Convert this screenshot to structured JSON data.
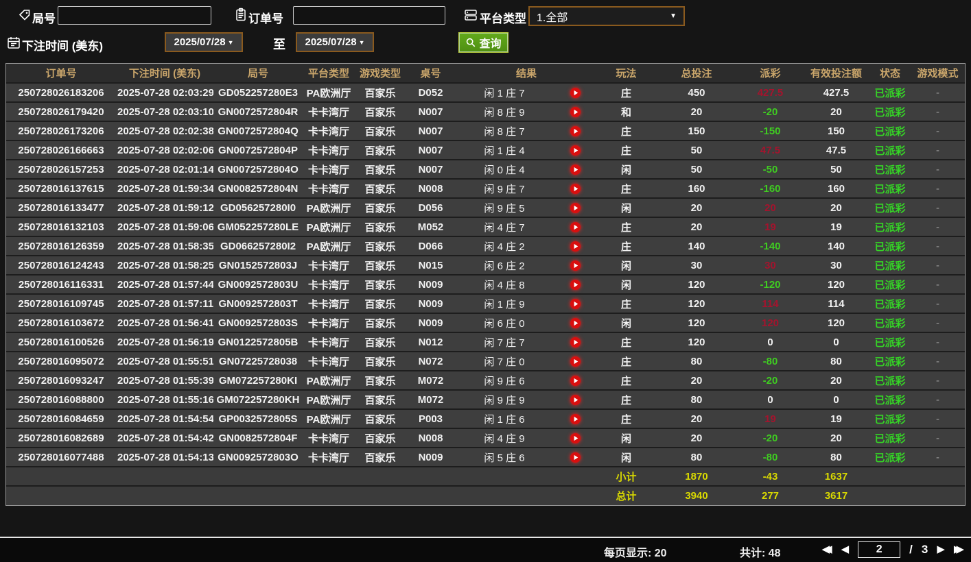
{
  "filters": {
    "game_no_label": "局号",
    "game_no_value": "",
    "order_no_label": "订单号",
    "order_no_value": "",
    "platform_label": "平台类型",
    "platform_value": "1.全部",
    "bet_time_label": "下注时间 (美东)",
    "date_from": "2025/07/28",
    "to_label": "至",
    "date_to": "2025/07/28",
    "search_label": "查询"
  },
  "icons": {
    "dropdown_arrow": "▼",
    "first_page": "◀◀",
    "prev_page": "◀",
    "next_page": "▶",
    "last_page": "▶▶"
  },
  "colors": {
    "header_gold": "#caa66b",
    "payout_win_red": "#a5132d",
    "payout_loss_green": "#3fcc21",
    "status_green": "#35d426",
    "summary_yellow": "#dada00",
    "button_green": "#55a016",
    "picker_border_orange": "#8a5a1e"
  },
  "table": {
    "headers": [
      "订单号",
      "下注时间 (美东)",
      "局号",
      "平台类型",
      "游戏类型",
      "桌号",
      "结果",
      "玩法",
      "总投注",
      "派彩",
      "有效投注额",
      "状态",
      "游戏模式"
    ],
    "rows": [
      {
        "order": "250728026183206",
        "time": "2025-07-28 02:03:29",
        "game": "GD052257280E3",
        "platform": "PA欧洲厅",
        "game_type": "百家乐",
        "table_no": "D052",
        "result": "闲 1 庄 7",
        "play": "庄",
        "bet": "450",
        "payout": "427.5",
        "payout_class": "win",
        "valid": "427.5",
        "status": "已派彩",
        "mode": "-"
      },
      {
        "order": "250728026179420",
        "time": "2025-07-28 02:03:10",
        "game": "GN0072572804R",
        "platform": "卡卡湾厅",
        "game_type": "百家乐",
        "table_no": "N007",
        "result": "闲 8 庄 9",
        "play": "和",
        "bet": "20",
        "payout": "-20",
        "payout_class": "loss",
        "valid": "20",
        "status": "已派彩",
        "mode": "-"
      },
      {
        "order": "250728026173206",
        "time": "2025-07-28 02:02:38",
        "game": "GN0072572804Q",
        "platform": "卡卡湾厅",
        "game_type": "百家乐",
        "table_no": "N007",
        "result": "闲 8 庄 7",
        "play": "庄",
        "bet": "150",
        "payout": "-150",
        "payout_class": "loss",
        "valid": "150",
        "status": "已派彩",
        "mode": "-"
      },
      {
        "order": "250728026166663",
        "time": "2025-07-28 02:02:06",
        "game": "GN0072572804P",
        "platform": "卡卡湾厅",
        "game_type": "百家乐",
        "table_no": "N007",
        "result": "闲 1 庄 4",
        "play": "庄",
        "bet": "50",
        "payout": "47.5",
        "payout_class": "win",
        "valid": "47.5",
        "status": "已派彩",
        "mode": "-"
      },
      {
        "order": "250728026157253",
        "time": "2025-07-28 02:01:14",
        "game": "GN0072572804O",
        "platform": "卡卡湾厅",
        "game_type": "百家乐",
        "table_no": "N007",
        "result": "闲 0 庄 4",
        "play": "闲",
        "bet": "50",
        "payout": "-50",
        "payout_class": "loss",
        "valid": "50",
        "status": "已派彩",
        "mode": "-"
      },
      {
        "order": "250728016137615",
        "time": "2025-07-28 01:59:34",
        "game": "GN0082572804N",
        "platform": "卡卡湾厅",
        "game_type": "百家乐",
        "table_no": "N008",
        "result": "闲 9 庄 7",
        "play": "庄",
        "bet": "160",
        "payout": "-160",
        "payout_class": "loss",
        "valid": "160",
        "status": "已派彩",
        "mode": "-"
      },
      {
        "order": "250728016133477",
        "time": "2025-07-28 01:59:12",
        "game": "GD056257280I0",
        "platform": "PA欧洲厅",
        "game_type": "百家乐",
        "table_no": "D056",
        "result": "闲 9 庄 5",
        "play": "闲",
        "bet": "20",
        "payout": "20",
        "payout_class": "win",
        "valid": "20",
        "status": "已派彩",
        "mode": "-"
      },
      {
        "order": "250728016132103",
        "time": "2025-07-28 01:59:06",
        "game": "GM052257280LE",
        "platform": "PA欧洲厅",
        "game_type": "百家乐",
        "table_no": "M052",
        "result": "闲 4 庄 7",
        "play": "庄",
        "bet": "20",
        "payout": "19",
        "payout_class": "win",
        "valid": "19",
        "status": "已派彩",
        "mode": "-"
      },
      {
        "order": "250728016126359",
        "time": "2025-07-28 01:58:35",
        "game": "GD066257280I2",
        "platform": "PA欧洲厅",
        "game_type": "百家乐",
        "table_no": "D066",
        "result": "闲 4 庄 2",
        "play": "庄",
        "bet": "140",
        "payout": "-140",
        "payout_class": "loss",
        "valid": "140",
        "status": "已派彩",
        "mode": "-"
      },
      {
        "order": "250728016124243",
        "time": "2025-07-28 01:58:25",
        "game": "GN0152572803J",
        "platform": "卡卡湾厅",
        "game_type": "百家乐",
        "table_no": "N015",
        "result": "闲 6 庄 2",
        "play": "闲",
        "bet": "30",
        "payout": "30",
        "payout_class": "win",
        "valid": "30",
        "status": "已派彩",
        "mode": "-"
      },
      {
        "order": "250728016116331",
        "time": "2025-07-28 01:57:44",
        "game": "GN0092572803U",
        "platform": "卡卡湾厅",
        "game_type": "百家乐",
        "table_no": "N009",
        "result": "闲 4 庄 8",
        "play": "闲",
        "bet": "120",
        "payout": "-120",
        "payout_class": "loss",
        "valid": "120",
        "status": "已派彩",
        "mode": "-"
      },
      {
        "order": "250728016109745",
        "time": "2025-07-28 01:57:11",
        "game": "GN0092572803T",
        "platform": "卡卡湾厅",
        "game_type": "百家乐",
        "table_no": "N009",
        "result": "闲 1 庄 9",
        "play": "庄",
        "bet": "120",
        "payout": "114",
        "payout_class": "win",
        "valid": "114",
        "status": "已派彩",
        "mode": "-"
      },
      {
        "order": "250728016103672",
        "time": "2025-07-28 01:56:41",
        "game": "GN0092572803S",
        "platform": "卡卡湾厅",
        "game_type": "百家乐",
        "table_no": "N009",
        "result": "闲 6 庄 0",
        "play": "闲",
        "bet": "120",
        "payout": "120",
        "payout_class": "win",
        "valid": "120",
        "status": "已派彩",
        "mode": "-"
      },
      {
        "order": "250728016100526",
        "time": "2025-07-28 01:56:19",
        "game": "GN0122572805B",
        "platform": "卡卡湾厅",
        "game_type": "百家乐",
        "table_no": "N012",
        "result": "闲 7 庄 7",
        "play": "庄",
        "bet": "120",
        "payout": "0",
        "payout_class": "zero",
        "valid": "0",
        "status": "已派彩",
        "mode": "-"
      },
      {
        "order": "250728016095072",
        "time": "2025-07-28 01:55:51",
        "game": "GN07225728038",
        "platform": "卡卡湾厅",
        "game_type": "百家乐",
        "table_no": "N072",
        "result": "闲 7 庄 0",
        "play": "庄",
        "bet": "80",
        "payout": "-80",
        "payout_class": "loss",
        "valid": "80",
        "status": "已派彩",
        "mode": "-"
      },
      {
        "order": "250728016093247",
        "time": "2025-07-28 01:55:39",
        "game": "GM072257280KI",
        "platform": "PA欧洲厅",
        "game_type": "百家乐",
        "table_no": "M072",
        "result": "闲 9 庄 6",
        "play": "庄",
        "bet": "20",
        "payout": "-20",
        "payout_class": "loss",
        "valid": "20",
        "status": "已派彩",
        "mode": "-"
      },
      {
        "order": "250728016088800",
        "time": "2025-07-28 01:55:16",
        "game": "GM072257280KH",
        "platform": "PA欧洲厅",
        "game_type": "百家乐",
        "table_no": "M072",
        "result": "闲 9 庄 9",
        "play": "庄",
        "bet": "80",
        "payout": "0",
        "payout_class": "zero",
        "valid": "0",
        "status": "已派彩",
        "mode": "-"
      },
      {
        "order": "250728016084659",
        "time": "2025-07-28 01:54:54",
        "game": "GP0032572805S",
        "platform": "PA欧洲厅",
        "game_type": "百家乐",
        "table_no": "P003",
        "result": "闲 1 庄 6",
        "play": "庄",
        "bet": "20",
        "payout": "19",
        "payout_class": "win",
        "valid": "19",
        "status": "已派彩",
        "mode": "-"
      },
      {
        "order": "250728016082689",
        "time": "2025-07-28 01:54:42",
        "game": "GN0082572804F",
        "platform": "卡卡湾厅",
        "game_type": "百家乐",
        "table_no": "N008",
        "result": "闲 4 庄 9",
        "play": "闲",
        "bet": "20",
        "payout": "-20",
        "payout_class": "loss",
        "valid": "20",
        "status": "已派彩",
        "mode": "-"
      },
      {
        "order": "250728016077488",
        "time": "2025-07-28 01:54:13",
        "game": "GN0092572803O",
        "platform": "卡卡湾厅",
        "game_type": "百家乐",
        "table_no": "N009",
        "result": "闲 5 庄 6",
        "play": "闲",
        "bet": "80",
        "payout": "-80",
        "payout_class": "loss",
        "valid": "80",
        "status": "已派彩",
        "mode": "-"
      }
    ],
    "subtotal": {
      "label": "小计",
      "bet": "1870",
      "payout": "-43",
      "valid": "1637"
    },
    "total": {
      "label": "总计",
      "bet": "3940",
      "payout": "277",
      "valid": "3617"
    }
  },
  "footer": {
    "per_page_label": "每页显示: 20",
    "total_label": "共计: 48",
    "page": "2",
    "page_sep": "/",
    "total_pages": "3"
  }
}
